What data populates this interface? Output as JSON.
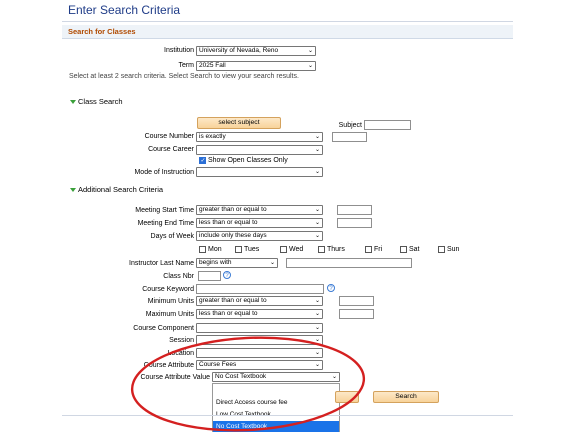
{
  "page_title": "Enter Search Criteria",
  "section_header": "Search for Classes",
  "institution": {
    "label": "Institution",
    "value": "University of Nevada, Reno"
  },
  "term": {
    "label": "Term",
    "value": "2025 Fall"
  },
  "instruction": "Select at least 2 search criteria. Select Search to view your search results.",
  "class_search": {
    "title": "Class Search",
    "select_subject_label": "select subject",
    "subject_label": "Subject",
    "course_number": {
      "label": "Course Number",
      "value": "is exactly"
    },
    "course_career": {
      "label": "Course Career",
      "value": ""
    },
    "open_classes": {
      "label": "Show Open Classes Only",
      "checked": true
    },
    "mode_of_instruction": {
      "label": "Mode of Instruction",
      "value": ""
    }
  },
  "additional": {
    "title": "Additional Search Criteria",
    "meeting_start": {
      "label": "Meeting Start Time",
      "value": "greater than or equal to"
    },
    "meeting_end": {
      "label": "Meeting End Time",
      "value": "less than or equal to"
    },
    "days_of_week": {
      "label": "Days of Week",
      "value": "include only these days"
    },
    "days": [
      "Mon",
      "Tues",
      "Wed",
      "Thurs",
      "Fri",
      "Sat",
      "Sun"
    ],
    "instructor": {
      "label": "Instructor Last Name",
      "value": "begins with"
    },
    "class_nbr": {
      "label": "Class Nbr"
    },
    "course_keyword": {
      "label": "Course Keyword"
    },
    "min_units": {
      "label": "Minimum Units",
      "value": "greater than or equal to"
    },
    "max_units": {
      "label": "Maximum Units",
      "value": "less than or equal to"
    },
    "course_component": {
      "label": "Course Component",
      "value": ""
    },
    "session": {
      "label": "Session",
      "value": ""
    },
    "location": {
      "label": "Location",
      "value": ""
    },
    "course_attribute": {
      "label": "Course Attribute",
      "value": "Course Fees"
    },
    "course_attribute_value": {
      "label": "Course Attribute Value",
      "value": "No Cost Textbook"
    }
  },
  "dropdown_options": [
    "",
    "Direct Access course fee",
    "Low Cost Textbook",
    "No Cost Textbook"
  ],
  "search_label": "Search",
  "annotation_color": "#d42020",
  "accent_color": "#1a73e8"
}
